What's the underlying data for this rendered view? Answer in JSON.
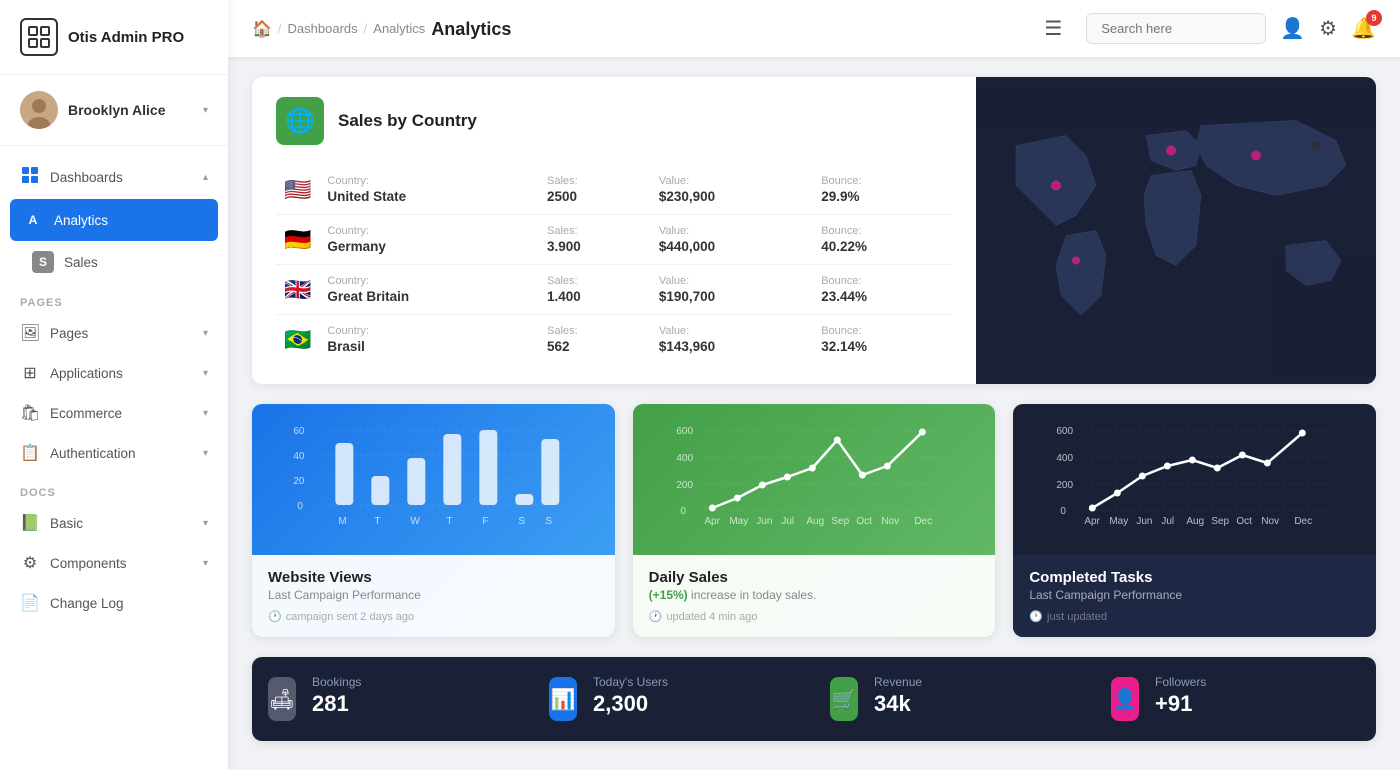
{
  "app": {
    "name": "Otis Admin PRO"
  },
  "sidebar": {
    "profile": {
      "name": "Brooklyn Alice"
    },
    "nav_sections": [
      {
        "label": "",
        "items": [
          {
            "id": "dashboards",
            "label": "Dashboards",
            "icon": "grid",
            "badge": null,
            "active": false,
            "expanded": true
          },
          {
            "id": "analytics",
            "label": "Analytics",
            "icon": "A",
            "badge": "A",
            "active": true
          },
          {
            "id": "sales",
            "label": "Sales",
            "icon": "S",
            "badge": "S",
            "active": false
          }
        ]
      },
      {
        "label": "PAGES",
        "items": [
          {
            "id": "pages",
            "label": "Pages",
            "icon": "image",
            "active": false
          },
          {
            "id": "applications",
            "label": "Applications",
            "icon": "grid4",
            "active": false
          },
          {
            "id": "ecommerce",
            "label": "Ecommerce",
            "icon": "bag",
            "active": false
          },
          {
            "id": "authentication",
            "label": "Authentication",
            "icon": "clipboard",
            "active": false
          }
        ]
      },
      {
        "label": "DOCS",
        "items": [
          {
            "id": "basic",
            "label": "Basic",
            "icon": "book",
            "active": false
          },
          {
            "id": "components",
            "label": "Components",
            "icon": "gear",
            "active": false
          },
          {
            "id": "changelog",
            "label": "Change Log",
            "icon": "list",
            "active": false
          }
        ]
      }
    ]
  },
  "header": {
    "breadcrumb": [
      "home",
      "Dashboards",
      "Analytics"
    ],
    "title": "Analytics",
    "menu_icon": "☰",
    "search_placeholder": "Search here",
    "notification_count": "9"
  },
  "sales_by_country": {
    "title": "Sales by Country",
    "countries": [
      {
        "flag": "🇺🇸",
        "country_label": "Country:",
        "country": "United State",
        "sales_label": "Sales:",
        "sales": "2500",
        "value_label": "Value:",
        "value": "$230,900",
        "bounce_label": "Bounce:",
        "bounce": "29.9%"
      },
      {
        "flag": "🇩🇪",
        "country_label": "Country:",
        "country": "Germany",
        "sales_label": "Sales:",
        "sales": "3.900",
        "value_label": "Value:",
        "value": "$440,000",
        "bounce_label": "Bounce:",
        "bounce": "40.22%"
      },
      {
        "flag": "🇬🇧",
        "country_label": "Country:",
        "country": "Great Britain",
        "sales_label": "Sales:",
        "sales": "1.400",
        "value_label": "Value:",
        "value": "$190,700",
        "bounce_label": "Bounce:",
        "bounce": "23.44%"
      },
      {
        "flag": "🇧🇷",
        "country_label": "Country:",
        "country": "Brasil",
        "sales_label": "Sales:",
        "sales": "562",
        "value_label": "Value:",
        "value": "$143,960",
        "bounce_label": "Bounce:",
        "bounce": "32.14%"
      }
    ]
  },
  "charts": {
    "website_views": {
      "title": "Website Views",
      "subtitle": "Last Campaign Performance",
      "meta": "campaign sent 2 days ago",
      "y_labels": [
        "60",
        "40",
        "20",
        "0"
      ],
      "x_labels": [
        "M",
        "T",
        "W",
        "T",
        "F",
        "S",
        "S"
      ],
      "bars": [
        45,
        20,
        35,
        55,
        60,
        10,
        50
      ]
    },
    "daily_sales": {
      "title": "Daily Sales",
      "highlight": "(+15%)",
      "subtitle": " increase in today sales.",
      "meta": "updated 4 min ago",
      "y_labels": [
        "600",
        "400",
        "200",
        "0"
      ],
      "x_labels": [
        "Apr",
        "May",
        "Jun",
        "Jul",
        "Aug",
        "Sep",
        "Oct",
        "Nov",
        "Dec"
      ],
      "points": [
        10,
        50,
        130,
        200,
        280,
        420,
        230,
        300,
        520
      ]
    },
    "completed_tasks": {
      "title": "Completed Tasks",
      "subtitle": "Last Campaign Performance",
      "meta": "just updated",
      "y_labels": [
        "600",
        "400",
        "200",
        "0"
      ],
      "x_labels": [
        "Apr",
        "May",
        "Jun",
        "Jul",
        "Aug",
        "Sep",
        "Oct",
        "Nov",
        "Dec"
      ],
      "points": [
        20,
        80,
        180,
        260,
        320,
        280,
        350,
        300,
        500
      ]
    }
  },
  "stats": [
    {
      "icon": "🛋",
      "icon_bg": "#555",
      "label": "Bookings",
      "value": "281"
    },
    {
      "icon": "📊",
      "icon_bg": "#1a73e8",
      "label": "Today's Users",
      "value": "2,300"
    },
    {
      "icon": "🛒",
      "icon_bg": "#43a047",
      "label": "Revenue",
      "value": "34k"
    },
    {
      "icon": "👤",
      "icon_bg": "#e91e8c",
      "label": "Followers",
      "value": "+91"
    }
  ]
}
